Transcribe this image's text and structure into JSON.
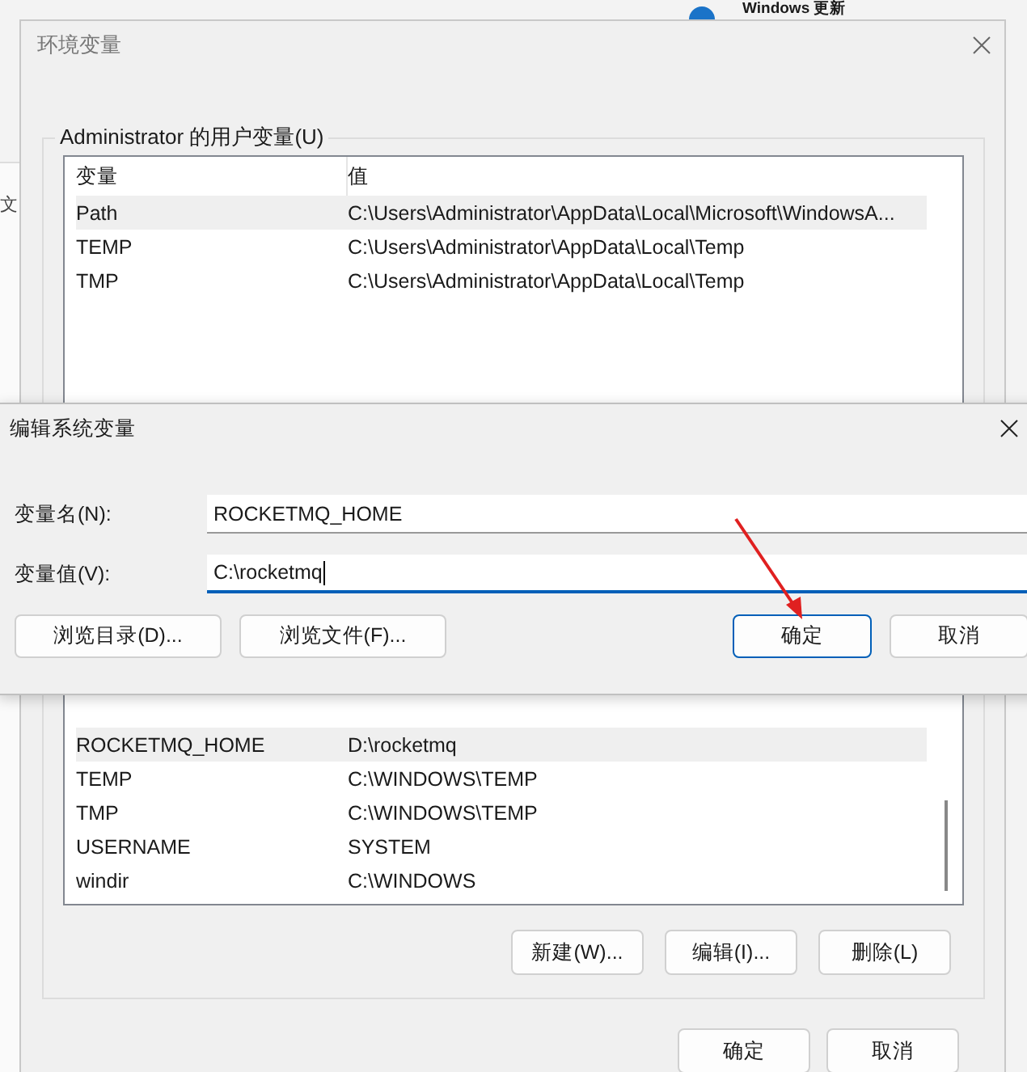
{
  "background": {
    "update_title": "Windows 更新",
    "left_text": "文"
  },
  "env_window": {
    "title": "环境变量",
    "user_group": {
      "title": "Administrator 的用户变量(U)",
      "columns": [
        "变量",
        "值"
      ],
      "rows": [
        {
          "name": "Path",
          "value": "C:\\Users\\Administrator\\AppData\\Local\\Microsoft\\WindowsA...",
          "selected": true
        },
        {
          "name": "TEMP",
          "value": "C:\\Users\\Administrator\\AppData\\Local\\Temp",
          "selected": false
        },
        {
          "name": "TMP",
          "value": "C:\\Users\\Administrator\\AppData\\Local\\Temp",
          "selected": false
        }
      ]
    },
    "system_group": {
      "rows": [
        {
          "name": "ROCKETMQ_HOME",
          "value": "D:\\rocketmq",
          "selected": true
        },
        {
          "name": "TEMP",
          "value": "C:\\WINDOWS\\TEMP",
          "selected": false
        },
        {
          "name": "TMP",
          "value": "C:\\WINDOWS\\TEMP",
          "selected": false
        },
        {
          "name": "USERNAME",
          "value": "SYSTEM",
          "selected": false
        },
        {
          "name": "windir",
          "value": "C:\\WINDOWS",
          "selected": false
        }
      ],
      "buttons": [
        "新建(W)...",
        "编辑(I)...",
        "删除(L)"
      ]
    },
    "buttons": [
      "确定",
      "取消"
    ]
  },
  "edit_dialog": {
    "title": "编辑系统变量",
    "fields": [
      {
        "label": "变量名(N):",
        "value": "ROCKETMQ_HOME",
        "focused": false
      },
      {
        "label": "变量值(V):",
        "value": "C:\\rocketmq",
        "focused": true
      }
    ],
    "buttons": [
      {
        "label": "浏览目录(D)...",
        "default": false
      },
      {
        "label": "浏览文件(F)...",
        "default": false
      },
      {
        "label": "确定",
        "default": true
      },
      {
        "label": "取消",
        "default": false
      }
    ]
  }
}
